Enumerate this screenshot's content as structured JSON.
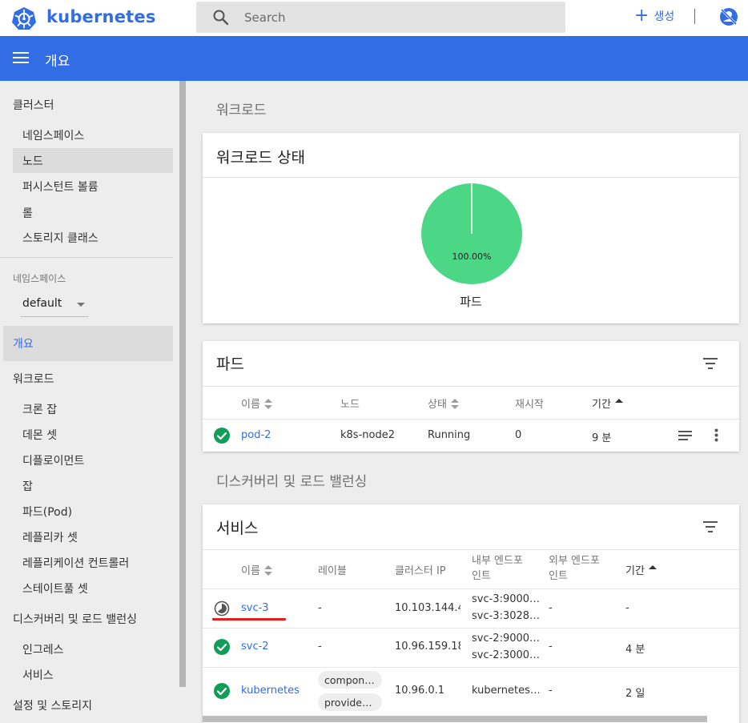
{
  "app": {
    "brand": "kubernetes",
    "search_placeholder": "Search",
    "create_label": "생성",
    "page_title": "개요"
  },
  "sidebar": {
    "cluster_header": "클러스터",
    "cluster_items": [
      "네임스페이스",
      "노드",
      "퍼시스턴트 볼륨",
      "롤",
      "스토리지 클래스"
    ],
    "namespace_label": "네임스페이스",
    "namespace_value": "default",
    "overview": "개요",
    "workloads_header": "워크로드",
    "workload_items": [
      "크론 잡",
      "데몬 셋",
      "디플로이먼트",
      "잡",
      "파드(Pod)",
      "레플리카 셋",
      "레플리케이션 컨트롤러",
      "스테이트풀 셋"
    ],
    "discovery_header": "디스커버리 및 로드 밸런싱",
    "discovery_items": [
      "인그레스",
      "서비스"
    ],
    "config_header": "설정 및 스토리지"
  },
  "workloads": {
    "section_title": "워크로드",
    "status_card_title": "워크로드 상태",
    "pie_label": "100.00%",
    "pie_caption": "파드",
    "pie_color": "#4cd787"
  },
  "pods": {
    "title": "파드",
    "columns": [
      "이름",
      "노드",
      "상태",
      "재시작",
      "기간"
    ],
    "rows": [
      {
        "name": "pod-2",
        "node": "k8s-node2",
        "status": "Running",
        "restarts": "0",
        "age": "9 분"
      }
    ]
  },
  "discovery": {
    "section_title": "디스커버리 및 로드 밸런싱",
    "services_title": "서비스",
    "columns": [
      "이름",
      "레이블",
      "클러스터 IP",
      "내부 엔드포\n인트",
      "외부 엔드포\n인트",
      "기간"
    ],
    "rows": [
      {
        "name": "svc-3",
        "labels": "-",
        "cluster_ip": "10.103.144.4",
        "internal_1": "svc-3:9000…",
        "internal_2": "svc-3:3028…",
        "external": "-",
        "age": "-"
      },
      {
        "name": "svc-2",
        "labels": "-",
        "cluster_ip": "10.96.159.18",
        "internal_1": "svc-2:9000…",
        "internal_2": "svc-2:3000…",
        "external": "-",
        "age": "4 분"
      },
      {
        "name": "kubernetes",
        "label_1": "componen…",
        "label_2": "provider: k…",
        "cluster_ip": "10.96.0.1",
        "internal_1": "kubernetes…",
        "external": "-",
        "age": "2 일"
      }
    ]
  },
  "colors": {
    "accent": "#326de6",
    "ok": "#0f9d58",
    "annotation_underline": "#e02020"
  }
}
